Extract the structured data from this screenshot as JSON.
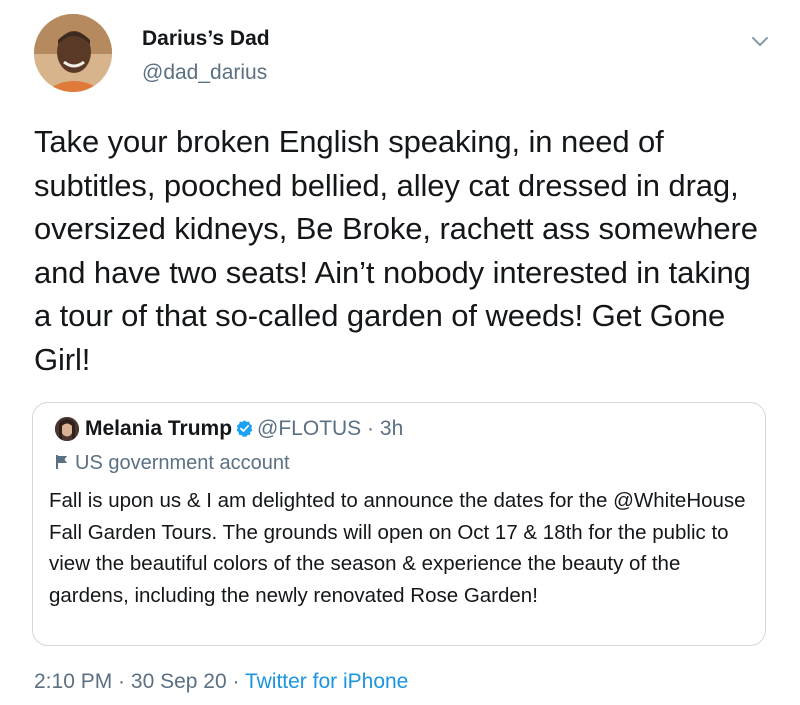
{
  "tweet": {
    "author": {
      "display_name": "Darius’s Dad",
      "handle": "@dad_darius",
      "avatar_icon": "profile-photo-avatar"
    },
    "menu_icon": "chevron-down-icon",
    "text": "Take your broken English speaking, in need of subtitles, pooched bellied, alley cat dressed in drag, oversized kidneys, Be Broke, rachett ass somewhere and have two seats! Ain’t nobody interested in taking a tour of that so-called garden of weeds! Get Gone Girl!",
    "quoted_tweet": {
      "display_name": "Melania Trump",
      "verified_icon": "verified-badge-icon",
      "handle": "@FLOTUS",
      "separator": "·",
      "time": "3h",
      "gov_label_icon": "flag-icon",
      "gov_label": "US government account",
      "text": "Fall is upon us & I am delighted to announce the dates for the @WhiteHouse Fall Garden Tours. The grounds will open on Oct 17 & 18th for the public to view the beautiful colors of the season & experience the beauty of the gardens, including the newly renovated Rose Garden!"
    },
    "meta": {
      "time": "2:10 PM",
      "sep1": " · ",
      "date": "30 Sep 20",
      "sep2": " · ",
      "source": "Twitter for iPhone"
    },
    "colors": {
      "text": "#14171a",
      "secondary": "#5b7083",
      "link": "#1b95e0",
      "verified": "#1da1f2",
      "border": "#cfd9de"
    }
  }
}
